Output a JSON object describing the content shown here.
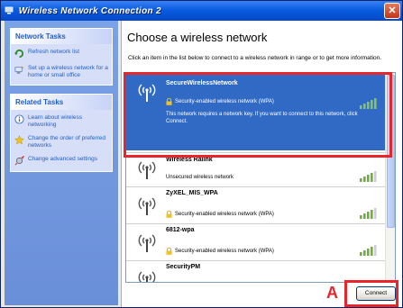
{
  "window": {
    "title": "Wireless Network Connection 2",
    "close_label": "✕"
  },
  "sidebar": {
    "network_tasks": {
      "header": "Network Tasks",
      "items": [
        {
          "label": "Refresh network list",
          "icon": "refresh-icon"
        },
        {
          "label": "Set up a wireless network for a home or small office",
          "icon": "setup-network-icon"
        }
      ]
    },
    "related_tasks": {
      "header": "Related Tasks",
      "items": [
        {
          "label": "Learn about wireless networking",
          "icon": "info-icon"
        },
        {
          "label": "Change the order of preferred networks",
          "icon": "star-icon"
        },
        {
          "label": "Change advanced settings",
          "icon": "settings-icon"
        }
      ]
    }
  },
  "main": {
    "heading": "Choose a wireless network",
    "instructions": "Click an item in the list below to connect to a wireless network in range or to get more information."
  },
  "networks": [
    {
      "name": "SecureWirelessNetwork",
      "security": "Security-enabled wireless network (WPA)",
      "description": "This network requires a network key. If you want to connect to this network, click Connect.",
      "signal_bars": 5,
      "selected": true
    },
    {
      "name": "Wireless Ralink",
      "security": "Unsecured wireless network",
      "signal_bars": 4,
      "selected": false
    },
    {
      "name": "ZyXEL_MIS_WPA",
      "security": "Security-enabled wireless network (WPA)",
      "signal_bars": 4,
      "selected": false
    },
    {
      "name": "6812-wpa",
      "security": "Security-enabled wireless network (WPA)",
      "signal_bars": 4,
      "selected": false
    },
    {
      "name": "SecurityPM",
      "security": "",
      "signal_bars": 0,
      "selected": false
    }
  ],
  "connect_button": {
    "label": "Connect"
  },
  "callout": {
    "label": "A"
  },
  "colors": {
    "highlight": "#e8252b",
    "selection": "#316ac5",
    "titlebar": "#0a5ce0",
    "sidebar": "#6a8fd9"
  }
}
